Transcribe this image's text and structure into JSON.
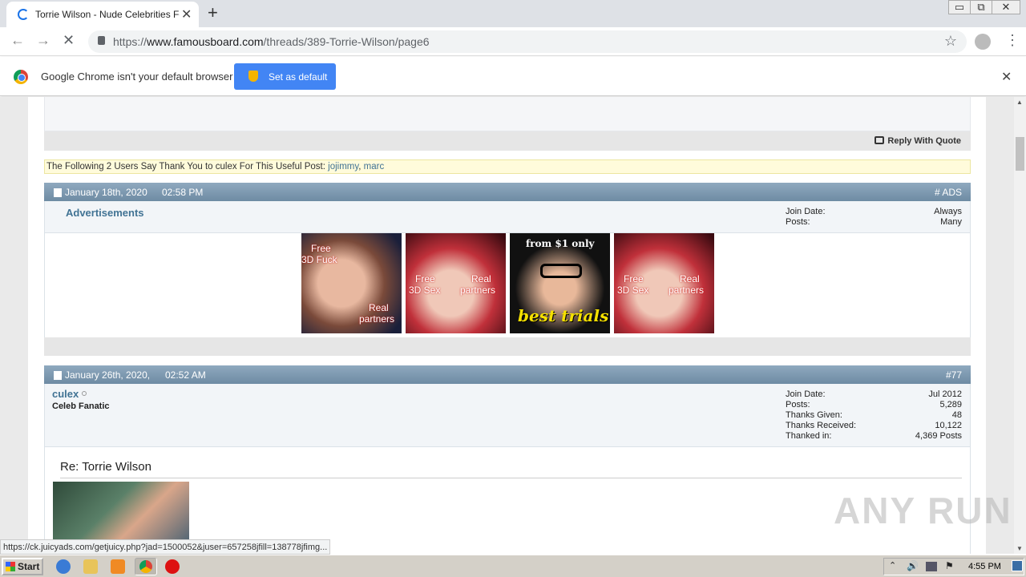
{
  "browser": {
    "tab_title": "Torrie Wilson - Nude Celebrities Forum",
    "new_tab": "+",
    "tab_close": "✕",
    "url_scheme": "https://",
    "url_host": "www.famousboard.com",
    "url_path": "/threads/389-Torrie-Wilson/page6",
    "window_min": "▭",
    "window_restore": "⧉",
    "window_close": "✕"
  },
  "infobar": {
    "message": "Google Chrome isn't your default browser",
    "button": "Set as default",
    "close": "✕"
  },
  "post76": {
    "reply_label": "Reply With Quote"
  },
  "thanks": {
    "prefix": "The Following 2 Users Say Thank You to culex For This Useful Post:",
    "users": [
      "jojimmy",
      "marc"
    ]
  },
  "ads_post": {
    "date": "January 18th, 2020",
    "time": "02:58 PM",
    "number": "# ADS",
    "title": "Advertisements",
    "info": [
      {
        "k": "Join Date:",
        "v": "Always"
      },
      {
        "k": "Posts:",
        "v": "Many"
      }
    ],
    "banners": [
      {
        "lines": [
          "Free",
          "3D Fuck"
        ],
        "lines2": [
          "Real",
          "partners"
        ]
      },
      {
        "lines": [
          "Free",
          "3D Sex"
        ],
        "lines2": [
          "Real",
          "partners"
        ]
      },
      {
        "lines": [
          "from $1 only"
        ],
        "lines2": [
          "best trials"
        ]
      },
      {
        "lines": [
          "Free",
          "3D Sex"
        ],
        "lines2": [
          "Real",
          "partners"
        ]
      }
    ]
  },
  "post77": {
    "date": "January 26th, 2020,",
    "time": "02:52 AM",
    "number": "#77",
    "username": "culex",
    "user_title": "Celeb Fanatic",
    "info": [
      {
        "k": "Join Date:",
        "v": "Jul 2012"
      },
      {
        "k": "Posts:",
        "v": "5,289"
      },
      {
        "k": "Thanks Given:",
        "v": "48"
      },
      {
        "k": "Thanks Received:",
        "v": "10,122"
      },
      {
        "k": "Thanked in:",
        "v": "4,369 Posts"
      }
    ],
    "title": "Re: Torrie Wilson"
  },
  "status_url": "https://ck.juicyads.com/getjuicy.php?jad=1500052&juser=657258jfill=138778jfimg...",
  "watermark": "ANY RUN",
  "taskbar": {
    "start": "Start",
    "clock": "4:55 PM"
  }
}
